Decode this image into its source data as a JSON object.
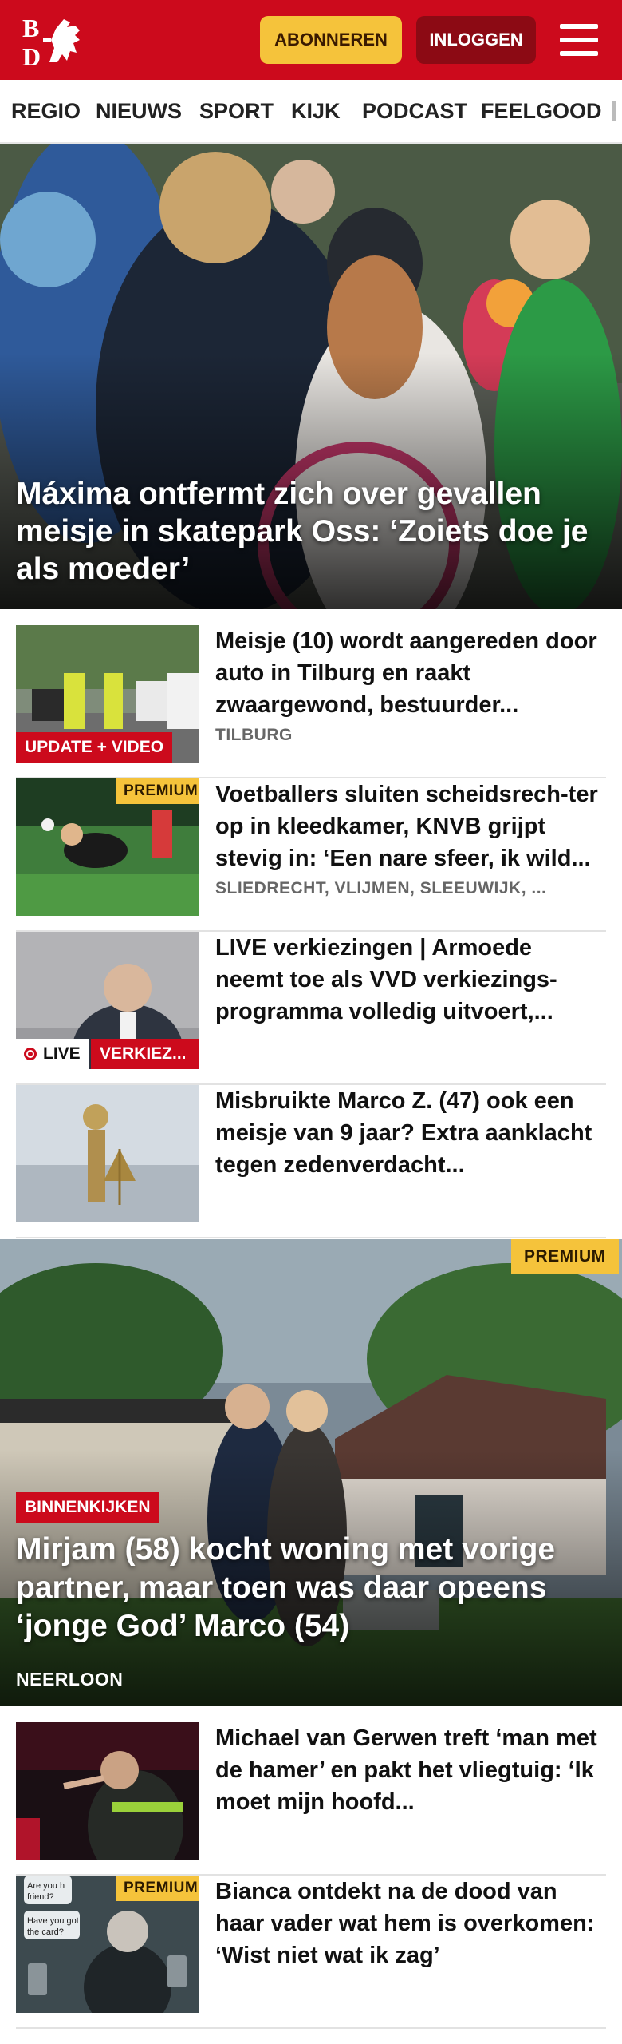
{
  "header": {
    "logo_text": "BD",
    "subscribe_label": "ABONNEREN",
    "login_label": "INLOGGEN",
    "menu_icon": "hamburger-menu-icon",
    "colors": {
      "brand_red": "#cc0a1c",
      "subscribe_yellow": "#f5c33b",
      "login_dark_red": "#8c0a14"
    }
  },
  "nav": {
    "items": [
      "REGIO",
      "NIEUWS",
      "SPORT",
      "KIJK",
      "PODCAST",
      "FEELGOOD"
    ]
  },
  "hero": {
    "title": "Máxima ontfermt zich over gevallen meisje in skatepark Oss: ‘Zoiets doe je als moeder’"
  },
  "articles": [
    {
      "title": "Meisje (10) wordt aangereden door auto in Tilburg en raakt zwaargewond, bestuurder...",
      "location": "TILBURG",
      "label": "UPDATE + VIDEO"
    },
    {
      "title": "Voetballers sluiten scheidsrech-ter op in kleedkamer, KNVB grijpt stevig in: ‘Een nare sfeer, ik wild...",
      "location": "SLIEDRECHT, VLIJMEN, SLEEUWIJK, ...",
      "premium": "PREMIUM"
    },
    {
      "title": "LIVE verkiezingen | Armoede neemt toe als VVD verkiezings-programma volledig uitvoert,...",
      "live": "LIVE",
      "label": "VERKIEZ..."
    },
    {
      "title": "Misbruikte Marco Z. (47) ook een meisje van 9 jaar? Extra aanklacht tegen zedenverdacht..."
    }
  ],
  "feature": {
    "premium": "PREMIUM",
    "label": "BINNENKIJKEN",
    "title": "Mirjam (58) kocht woning met vorige partner, maar toen was daar opeens ‘jonge God’ Marco (54)",
    "location": "NEERLOON"
  },
  "articles_bottom": [
    {
      "title": "Michael van Gerwen treft ‘man met de hamer’ en pakt het vliegtuig: ‘Ik moet mijn hoofd..."
    },
    {
      "title": "Bianca ontdekt na de dood van haar vader wat hem is overkomen: ‘Wist niet wat ik zag’",
      "premium": "PREMIUM",
      "thumb_text_1": "Are you h",
      "thumb_text_2": "friend?",
      "thumb_text_3": "Have you got",
      "thumb_text_4": "the card?"
    }
  ]
}
